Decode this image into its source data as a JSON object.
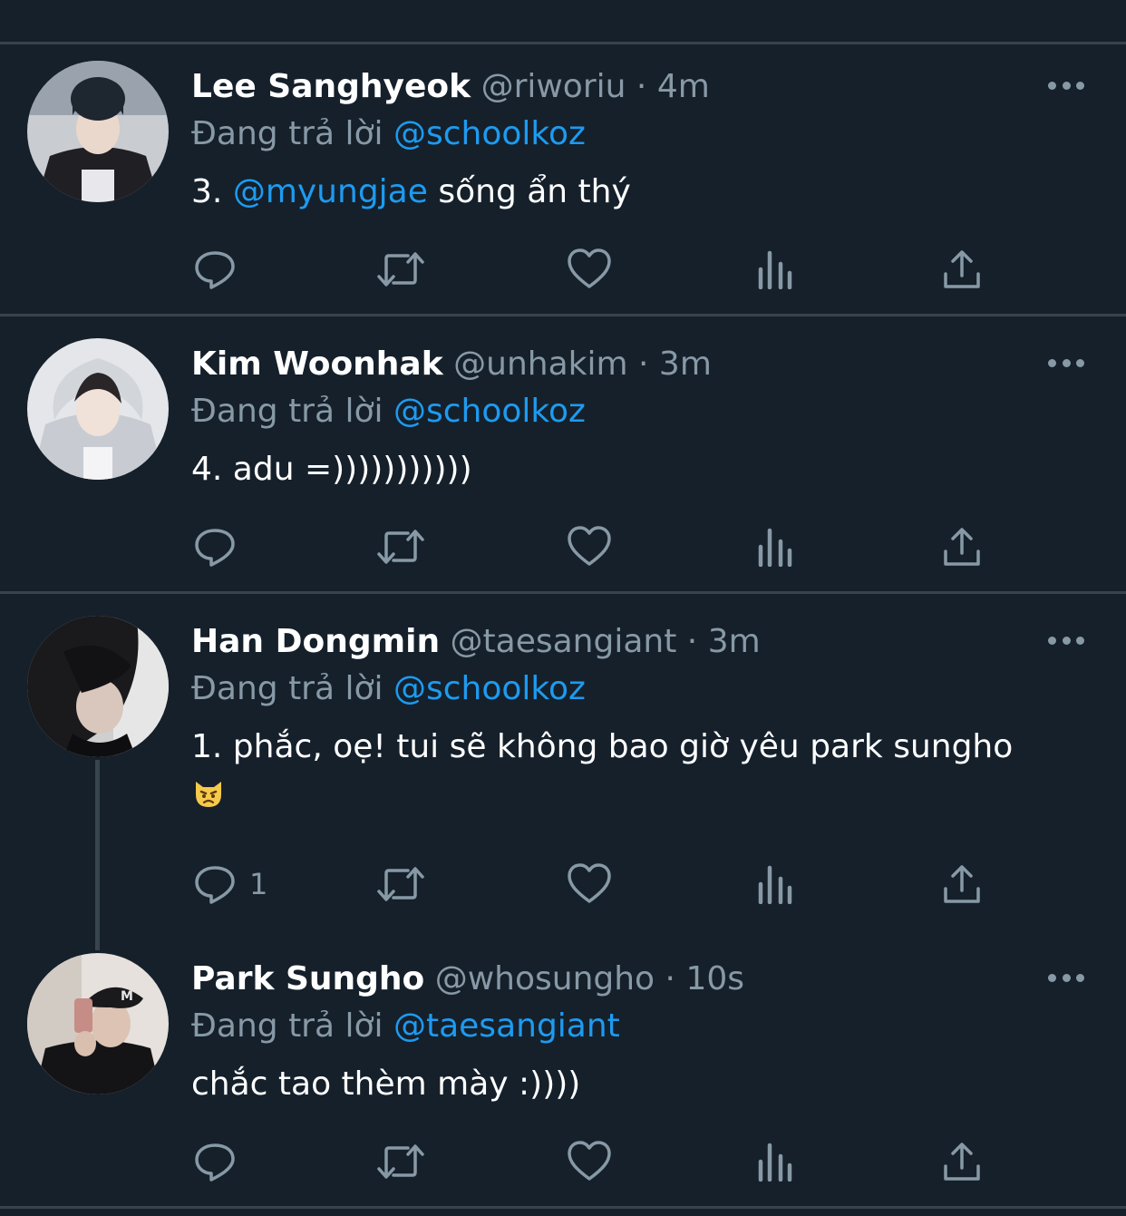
{
  "colors": {
    "background": "#15202b",
    "divider": "#38444d",
    "muted": "#8899a6",
    "mention": "#1d9bf0"
  },
  "tweets": [
    {
      "name": "Lee Sanghyeok",
      "handle": "@riworiu",
      "time": "4m",
      "reply_prefix": "Đang trả lời",
      "reply_to": "@schoolkoz",
      "text_pre": "3.",
      "text_mention": "@myungjae",
      "text_post": "sống ẩn thý",
      "reply_count": ""
    },
    {
      "name": "Kim Woonhak",
      "handle": "@unhakim",
      "time": "3m",
      "reply_prefix": "Đang trả lời",
      "reply_to": "@schoolkoz",
      "text": "4. adu =)))))))))))",
      "reply_count": ""
    },
    {
      "name": "Han Dongmin",
      "handle": "@taesangiant",
      "time": "3m",
      "reply_prefix": "Đang trả lời",
      "reply_to": "@schoolkoz",
      "text": "1. phắc, oẹ! tui sẽ không bao giờ yêu park sungho",
      "emoji": "pouting-cat-emoji",
      "reply_count": "1"
    },
    {
      "name": "Park Sungho",
      "handle": "@whosungho",
      "time": "10s",
      "reply_prefix": "Đang trả lời",
      "reply_to": "@taesangiant",
      "text": "chắc tao thèm mày :))))",
      "reply_count": ""
    }
  ],
  "icons": {
    "reply": "reply-icon",
    "retweet": "retweet-icon",
    "like": "heart-icon",
    "analytics": "analytics-icon",
    "share": "share-icon",
    "more": "more-icon"
  },
  "separator": "·"
}
